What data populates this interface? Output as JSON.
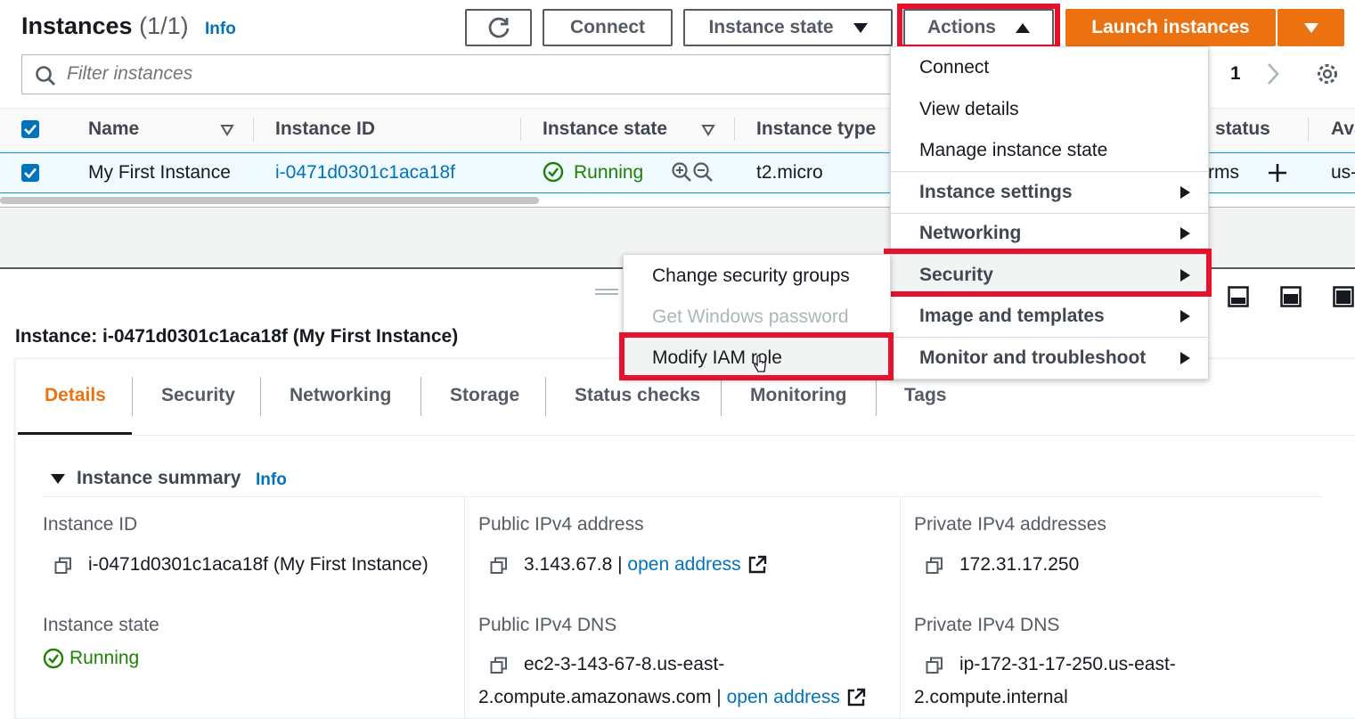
{
  "header": {
    "title": "Instances",
    "count": "(1/1)",
    "info": "Info",
    "connect_label": "Connect",
    "instance_state_label": "Instance state",
    "actions_label": "Actions",
    "launch_label": "Launch instances"
  },
  "search": {
    "placeholder": "Filter instances"
  },
  "pagination": {
    "page": "1"
  },
  "table": {
    "columns": [
      "Name",
      "Instance ID",
      "Instance state",
      "Instance type",
      "status",
      "Ava"
    ],
    "row": {
      "name": "My First Instance",
      "instance_id": "i-0471d0301c1aca18f",
      "state": "Running",
      "type": "t2.micro",
      "alarms": "rms",
      "az": "us-"
    }
  },
  "actions_menu": {
    "items": [
      {
        "label": "Connect"
      },
      {
        "label": "View details"
      },
      {
        "label": "Manage instance state"
      },
      {
        "label": "Instance settings"
      },
      {
        "label": "Networking"
      },
      {
        "label": "Security"
      },
      {
        "label": "Image and templates"
      },
      {
        "label": "Monitor and troubleshoot"
      }
    ]
  },
  "security_submenu": {
    "items": [
      {
        "label": "Change security groups"
      },
      {
        "label": "Get Windows password"
      },
      {
        "label": "Modify IAM role"
      }
    ]
  },
  "detail": {
    "title": "Instance: i-0471d0301c1aca18f (My First Instance)",
    "tabs": [
      "Details",
      "Security",
      "Networking",
      "Storage",
      "Status checks",
      "Monitoring",
      "Tags"
    ],
    "summary_title": "Instance summary",
    "summary_info": "Info",
    "instance_id_label": "Instance ID",
    "instance_id_value": "i-0471d0301c1aca18f (My First Instance)",
    "public_ipv4_label": "Public IPv4 address",
    "public_ipv4_value": "3.143.67.8 |",
    "open_address": "open address",
    "private_ipv4_label": "Private IPv4 addresses",
    "private_ipv4_value": "172.31.17.250",
    "instance_state_label": "Instance state",
    "instance_state_value": "Running",
    "public_dns_label": "Public IPv4 DNS",
    "public_dns_line1": "ec2-3-143-67-8.us-east-",
    "public_dns_line2": "2.compute.amazonaws.com |",
    "private_dns_label": "Private IPv4 DNS",
    "private_dns_line1": "ip-172-31-17-250.us-east-",
    "private_dns_line2": "2.compute.internal"
  },
  "colors": {
    "accent": "#ec7211",
    "link": "#0073bb",
    "success": "#1d8102",
    "highlight": "#e8112d"
  }
}
